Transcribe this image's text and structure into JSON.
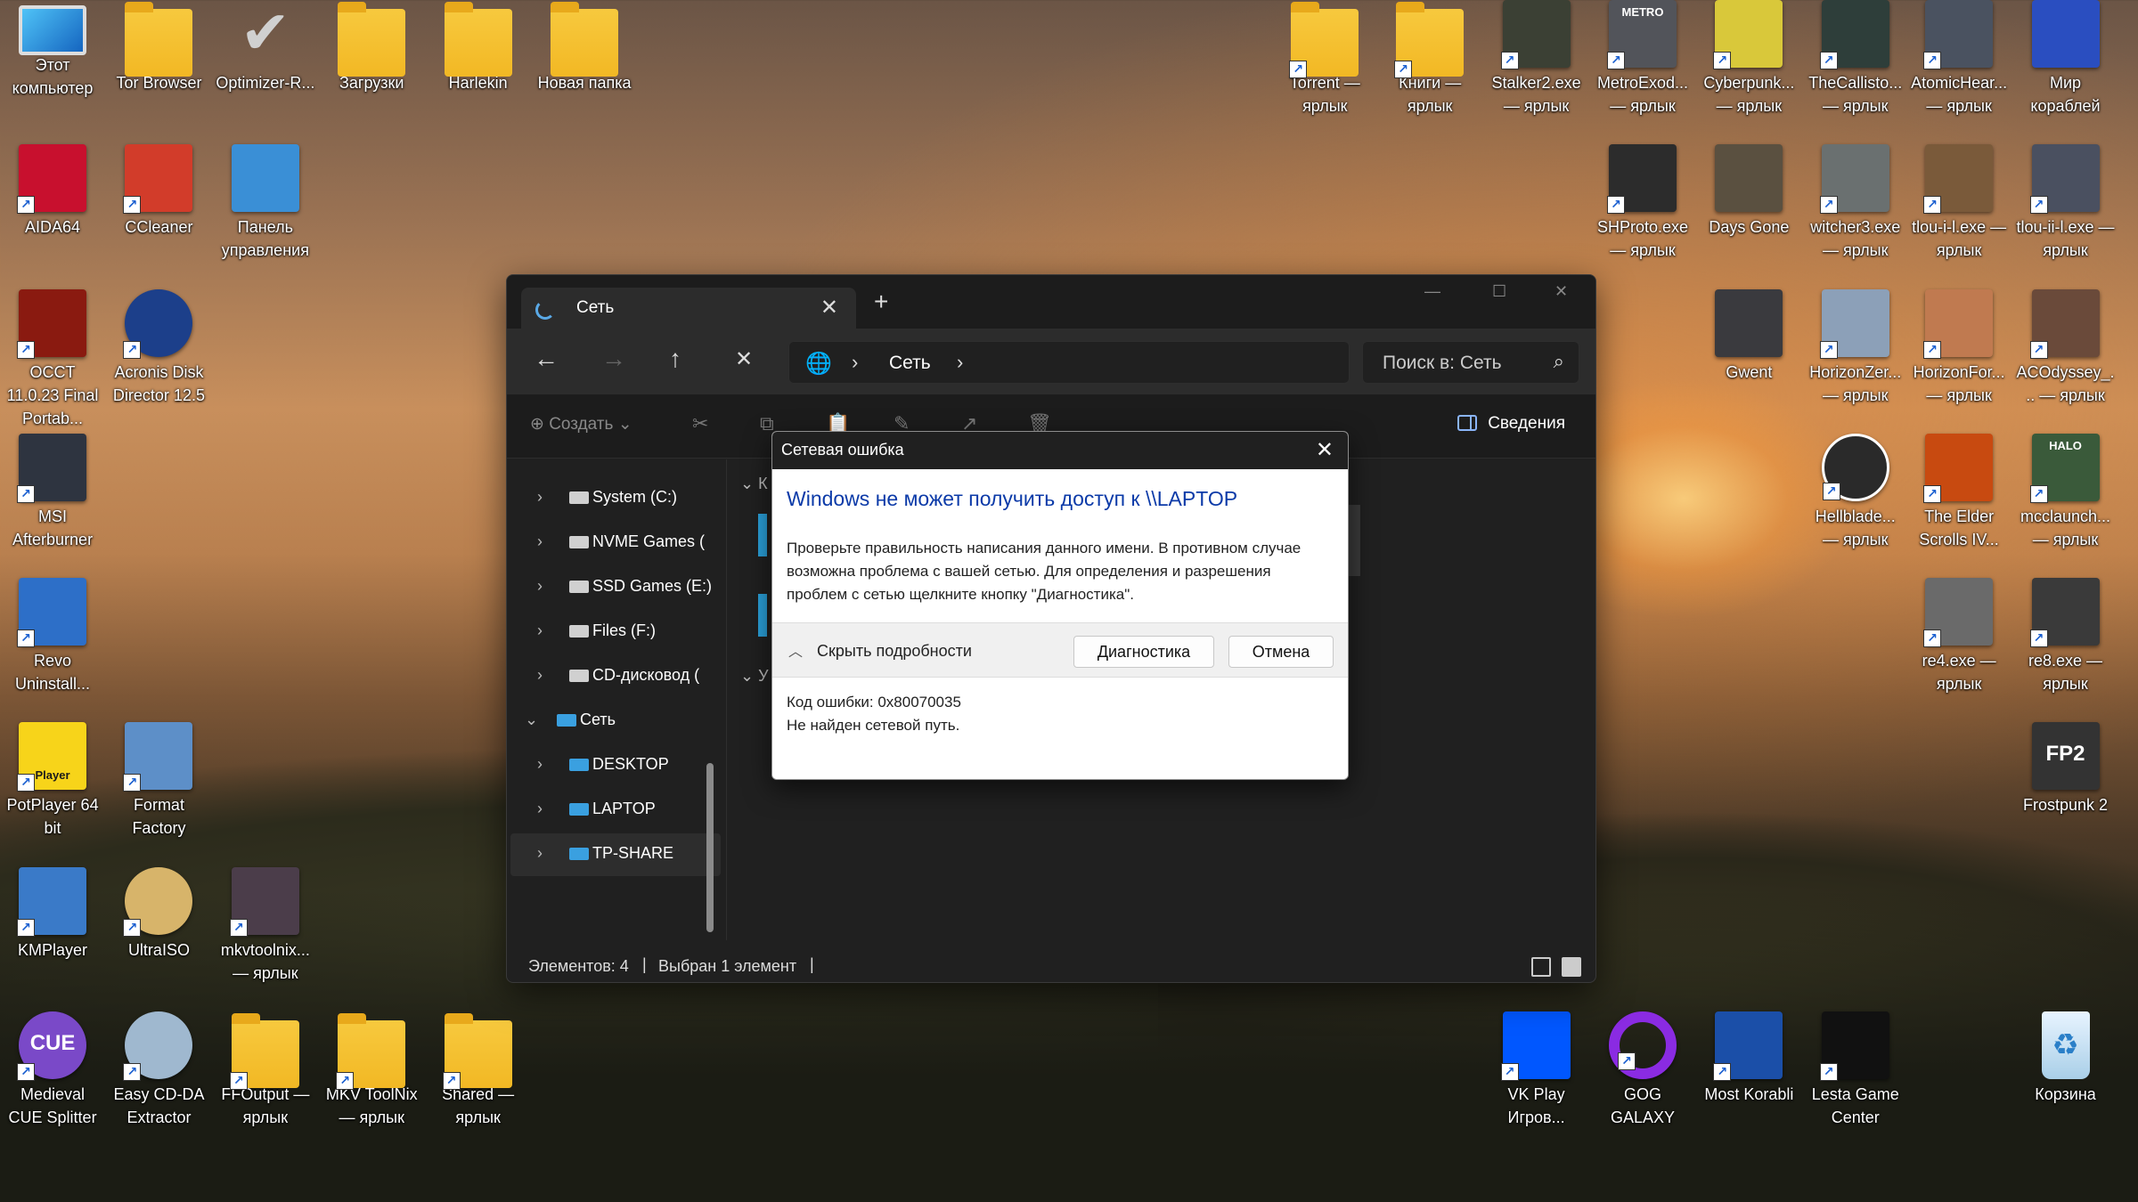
{
  "desktop": {
    "left_icons": [
      {
        "label": "Этот компьютер",
        "icon": "monitor-icon"
      },
      {
        "label": "Tor Browser",
        "icon": "folder-tor-icon"
      },
      {
        "label": "Optimizer-R...",
        "icon": "checkmark-icon"
      },
      {
        "label": "Загрузки",
        "icon": "downloads-folder-icon"
      },
      {
        "label": "Harlekin",
        "icon": "user-folder-icon"
      },
      {
        "label": "Новая папка",
        "icon": "folder-icon"
      },
      {
        "label": "AIDA64",
        "icon": "aida64-icon"
      },
      {
        "label": "CCleaner",
        "icon": "ccleaner-icon"
      },
      {
        "label": "Панель управления",
        "icon": "control-panel-icon"
      },
      {
        "label": "OCCT 11.0.23 Final Portab...",
        "icon": "occt-icon"
      },
      {
        "label": "Acronis Disk Director 12.5",
        "icon": "acronis-icon"
      },
      {
        "label": "MSI Afterburner",
        "icon": "afterburner-icon"
      },
      {
        "label": "Revo Uninstall...",
        "icon": "revo-icon"
      },
      {
        "label": "PotPlayer 64 bit",
        "icon": "potplayer-icon",
        "badge": "Player"
      },
      {
        "label": "Format Factory",
        "icon": "format-factory-icon"
      },
      {
        "label": "KMPlayer",
        "icon": "kmplayer-icon"
      },
      {
        "label": "UltraISO",
        "icon": "ultraiso-icon"
      },
      {
        "label": "mkvtoolnix... — ярлык",
        "icon": "mkvtoolnix-icon"
      },
      {
        "label": "Medieval CUE Splitter",
        "icon": "cue-splitter-icon",
        "badge": "CUE"
      },
      {
        "label": "Easy CD-DA Extractor",
        "icon": "cd-extractor-icon"
      },
      {
        "label": "FFOutput — ярлык",
        "icon": "folder-icon"
      },
      {
        "label": "MKV ToolNix — ярлык",
        "icon": "folder-icon"
      },
      {
        "label": "Shared — ярлык",
        "icon": "folder-icon"
      }
    ],
    "right_icons": [
      {
        "label": "Torrent — ярлык",
        "icon": "folder-icon"
      },
      {
        "label": "Книги — ярлык",
        "icon": "folder-icon"
      },
      {
        "label": "Stalker2.exe — ярлык",
        "icon": "stalker-icon"
      },
      {
        "label": "MetroExod... — ярлык",
        "icon": "metro-icon",
        "badge": "METRO"
      },
      {
        "label": "Cyberpunk... — ярлык",
        "icon": "cyberpunk-icon"
      },
      {
        "label": "TheCallisto... — ярлык",
        "icon": "callisto-icon"
      },
      {
        "label": "AtomicHear... — ярлык",
        "icon": "atomic-heart-icon"
      },
      {
        "label": "Мир кораблей",
        "icon": "mir-korabley-icon"
      },
      {
        "label": "SHProto.exe — ярлык",
        "icon": "shproto-icon"
      },
      {
        "label": "Days Gone",
        "icon": "days-gone-icon"
      },
      {
        "label": "witcher3.exe — ярлык",
        "icon": "witcher-icon"
      },
      {
        "label": "tlou-i-l.exe — ярлык",
        "icon": "tlou1-icon"
      },
      {
        "label": "tlou-ii-l.exe — ярлык",
        "icon": "tlou2-icon"
      },
      {
        "label": "Gwent",
        "icon": "gwent-icon"
      },
      {
        "label": "HorizonZer... — ярлык",
        "icon": "horizon-zero-icon"
      },
      {
        "label": "HorizonFor... — ярлык",
        "icon": "horizon-forbidden-icon"
      },
      {
        "label": "ACOdyssey_... — ярлык",
        "icon": "ac-odyssey-icon"
      },
      {
        "label": "Hellblade... — ярлык",
        "icon": "hellblade-icon"
      },
      {
        "label": "The Elder Scrolls IV...",
        "icon": "elder-scrolls-icon"
      },
      {
        "label": "mcclaunch... — ярлык",
        "icon": "halo-icon",
        "badge": "HALO"
      },
      {
        "label": "re4.exe — ярлык",
        "icon": "re4-icon"
      },
      {
        "label": "re8.exe — ярлык",
        "icon": "re8-icon"
      },
      {
        "label": "Frostpunk 2",
        "icon": "frostpunk-icon",
        "badge": "FP2"
      },
      {
        "label": "VK Play Игров...",
        "icon": "vk-play-icon"
      },
      {
        "label": "GOG GALAXY",
        "icon": "gog-icon"
      },
      {
        "label": "Most Korabli",
        "icon": "most-korabli-icon"
      },
      {
        "label": "Lesta Game Center",
        "icon": "lesta-icon"
      },
      {
        "label": "Корзина",
        "icon": "recycle-bin-icon"
      }
    ]
  },
  "explorer": {
    "tab_title": "Сеть",
    "new_tab": "+",
    "address_crumb": "Сеть",
    "search_placeholder": "Поиск в: Сеть",
    "create_label": "Создать",
    "details_label": "Сведения",
    "nav_items": [
      {
        "label": "System (C:)",
        "icon": "drive-icon"
      },
      {
        "label": "NVME Games (",
        "icon": "drive-icon"
      },
      {
        "label": "SSD Games (E:)",
        "icon": "drive-icon"
      },
      {
        "label": "Files (F:)",
        "icon": "drive-icon"
      },
      {
        "label": "CD-дисковод (",
        "icon": "cd-drive-icon"
      },
      {
        "label": "Сеть",
        "icon": "network-icon",
        "expanded": true
      },
      {
        "label": "DESKTOP",
        "icon": "computer-icon"
      },
      {
        "label": "LAPTOP",
        "icon": "computer-icon"
      },
      {
        "label": "TP-SHARE",
        "icon": "computer-icon",
        "selected": true
      }
    ],
    "content_peek_1": "К",
    "content_peek_2": "У",
    "status_items": "Элементов: 4",
    "status_selected": "Выбран 1 элемент"
  },
  "dialog": {
    "title": "Сетевая ошибка",
    "heading": "Windows не может получить доступ к \\\\LAPTOP",
    "message": "Проверьте правильность написания данного имени. В противном случае возможна проблема с вашей сетью. Для определения и разрешения проблем с сетью щелкните кнопку \"Диагностика\".",
    "toggle_label": "Скрыть подробности",
    "diagnose_button": "Диагностика",
    "cancel_button": "Отмена",
    "error_code": "Код ошибки: 0x80070035",
    "error_text": "Не найден сетевой путь."
  },
  "colors": {
    "accent_blue": "#0b3aa8",
    "folder_yellow": "#f2b824",
    "explorer_bg": "#202020"
  }
}
